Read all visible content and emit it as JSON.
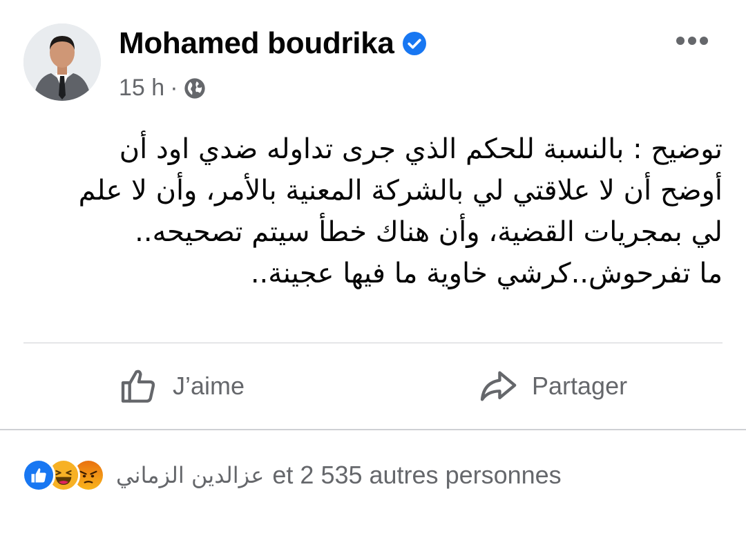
{
  "post": {
    "author": "Mohamed boudrika",
    "verified": true,
    "time": "15 h",
    "separator": "·",
    "audience_icon": "globe-icon",
    "text_lines": [
      "توضيح : بالنسبة للحكم الذي جرى تداوله ضدي اود أن",
      "أوضح أن لا علاقتي لي بالشركة المعنية بالأمر، وأن لا علم",
      "لي بمجريات القضية، وأن هناك خطأ سيتم تصحيحه..",
      "ما تفرحوش..كرشي خاوية ما فيها عجينة.."
    ]
  },
  "actions": {
    "like_label": "J’aime",
    "share_label": "Partager"
  },
  "reactions": {
    "icons": [
      "like-reaction-icon",
      "haha-reaction-icon",
      "angry-reaction-icon"
    ],
    "first_reactor": "عزالدين الزماني",
    "others_text": "et 2 535 autres personnes"
  },
  "colors": {
    "brand_blue": "#1877f2",
    "secondary_text": "#65676b",
    "divider": "#ced0d4"
  }
}
